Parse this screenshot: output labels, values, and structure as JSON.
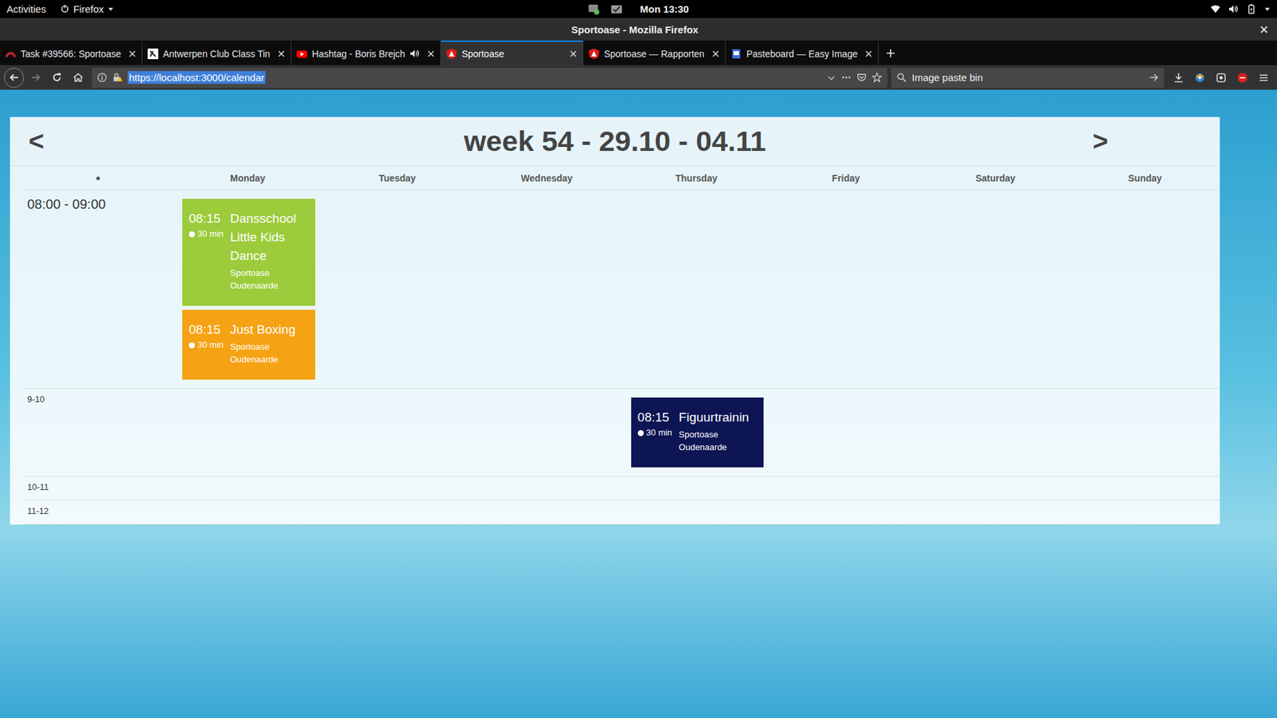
{
  "topbar": {
    "activities": "Activities",
    "app": "Firefox",
    "clock": "Mon 13:30"
  },
  "window": {
    "title": "Sportoase - Mozilla Firefox"
  },
  "tabs": [
    {
      "label": "Task #39566: Sportoase",
      "selected": false,
      "kind": "redmine",
      "audio": false
    },
    {
      "label": "Antwerpen Club Class Tin",
      "selected": false,
      "kind": "club",
      "audio": false
    },
    {
      "label": "Hashtag - Boris Brejch",
      "selected": false,
      "kind": "youtube",
      "audio": true
    },
    {
      "label": "Sportoase",
      "selected": true,
      "kind": "angular",
      "audio": false
    },
    {
      "label": "Sportoase — Rapporten",
      "selected": false,
      "kind": "angular",
      "audio": false
    },
    {
      "label": "Pasteboard — Easy Image",
      "selected": false,
      "kind": "pasteboard",
      "audio": false
    }
  ],
  "navigation": {
    "back_enabled": true,
    "forward_enabled": false,
    "url": "https://localhost:3000/calendar",
    "url_selected": true,
    "search": "Image paste bin"
  },
  "calendar": {
    "prev": "<",
    "next": ">",
    "title": "week 54 - 29.10 - 04.11",
    "corner": "●",
    "days": [
      "Monday",
      "Tuesday",
      "Wednesday",
      "Thursday",
      "Friday",
      "Saturday",
      "Sunday"
    ],
    "rows": [
      {
        "label": "08:00 - 09:00",
        "expanded": true,
        "cells": [
          [
            {
              "time": "08:15",
              "duration": "30 min",
              "title": "Dansschool Little Kids Dance",
              "location": "Sportoase Oudenaarde",
              "color": "#9ccb3b"
            },
            {
              "time": "08:15",
              "duration": "30 min",
              "title": "Just Boxing",
              "location": "Sportoase Oudenaarde",
              "color": "#f5a214"
            }
          ],
          [],
          [],
          [],
          [],
          [],
          []
        ]
      },
      {
        "label": "9-10",
        "expanded": false,
        "cells": [
          [],
          [],
          [],
          [
            {
              "time": "08:15",
              "duration": "30 min",
              "title": "Figuurtrainin",
              "location": "Sportoase Oudenaarde",
              "color": "#0d1554"
            }
          ],
          [],
          [],
          []
        ]
      },
      {
        "label": "10-11",
        "expanded": false,
        "cells": [
          [],
          [],
          [],
          [],
          [],
          [],
          []
        ]
      },
      {
        "label": "11-12",
        "expanded": false,
        "cells": [
          [],
          [],
          [],
          [],
          [],
          [],
          []
        ]
      }
    ]
  }
}
